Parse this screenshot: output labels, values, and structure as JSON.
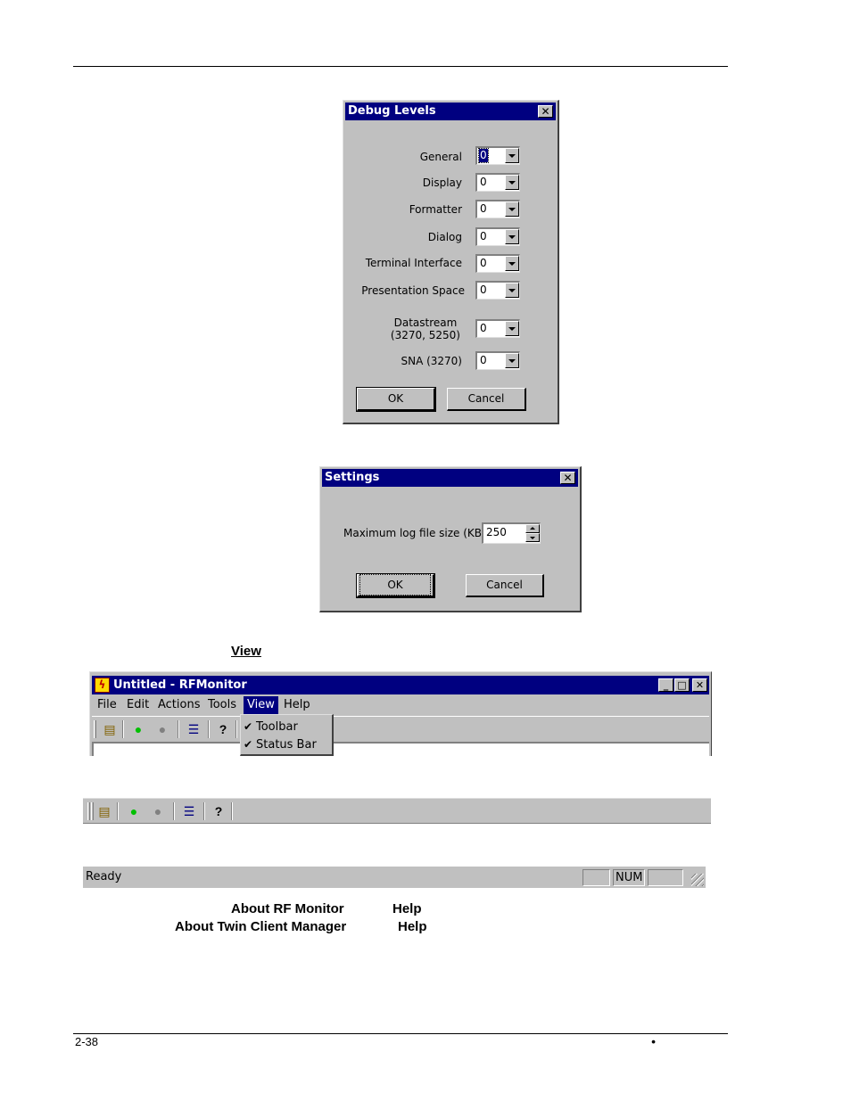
{
  "debug_dialog": {
    "title": "Debug Levels",
    "close": "✕",
    "fields": [
      {
        "label": "General",
        "value": "0"
      },
      {
        "label": "Display",
        "value": "0"
      },
      {
        "label": "Formatter",
        "value": "0"
      },
      {
        "label": "Dialog",
        "value": "0"
      },
      {
        "label": "Terminal Interface",
        "value": "0"
      },
      {
        "label": "Presentation Space",
        "value": "0"
      },
      {
        "label_line1": "Datastream",
        "label_line2": "(3270, 5250)",
        "value": "0"
      },
      {
        "label": "SNA (3270)",
        "value": "0"
      }
    ],
    "ok": "OK",
    "cancel": "Cancel"
  },
  "settings_dialog": {
    "title": "Settings",
    "close": "✕",
    "label": "Maximum log file size (KB) :",
    "value": "250",
    "ok": "OK",
    "cancel": "Cancel"
  },
  "body": {
    "view_word": "View",
    "about_rf": "About RF Monitor",
    "help1": "Help",
    "about_twin": "About Twin Client Manager",
    "help2": "Help"
  },
  "app_window": {
    "title": "Untitled - RFMonitor",
    "menu": [
      "File",
      "Edit",
      "Actions",
      "Tools",
      "View",
      "Help"
    ],
    "view_menu": [
      {
        "label": "Toolbar",
        "checked": true
      },
      {
        "label": "Status Bar",
        "checked": true
      }
    ],
    "minimize": "_",
    "maximize": "□",
    "close": "✕"
  },
  "status_bar": {
    "text": "Ready",
    "num": "NUM"
  },
  "footer": {
    "page_number": "2-38",
    "bullet": "•"
  },
  "colors": {
    "titlebar": "#000080",
    "dialog_bg": "#c0c0c0",
    "green_dot": "#00c000",
    "gray_dot": "#808080"
  }
}
